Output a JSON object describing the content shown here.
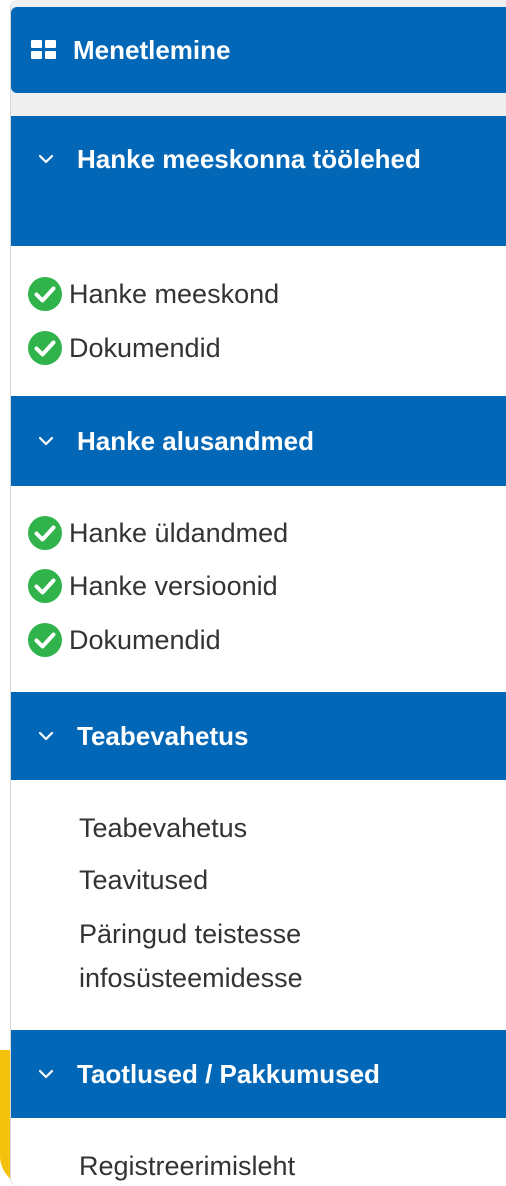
{
  "menu_header": {
    "label": "Menetlemine",
    "icon": "grid-icon"
  },
  "sections": [
    {
      "title": "Hanke meeskonna töölehed",
      "icon": "chevron-down-icon",
      "items": [
        {
          "label": "Hanke meeskond",
          "completed": true
        },
        {
          "label": "Dokumendid",
          "completed": true
        }
      ]
    },
    {
      "title": "Hanke alusandmed",
      "icon": "chevron-down-icon",
      "items": [
        {
          "label": "Hanke üldandmed",
          "completed": true
        },
        {
          "label": "Hanke versioonid",
          "completed": true
        },
        {
          "label": "Dokumendid",
          "completed": true
        }
      ]
    },
    {
      "title": "Teabevahetus",
      "icon": "chevron-down-icon",
      "items": [
        {
          "label": "Teabevahetus",
          "completed": false
        },
        {
          "label": "Teavitused",
          "completed": false
        },
        {
          "label": "Päringud teistesse infosüsteemidesse",
          "completed": false
        }
      ]
    },
    {
      "title": "Taotlused / Pakkumused",
      "icon": "chevron-down-icon",
      "items": [
        {
          "label": "Registreerimisleht",
          "completed": false
        }
      ]
    }
  ],
  "colors": {
    "header_blue": "#0367b7",
    "check_green": "#2fb34a",
    "accent_yellow": "#f4c20d"
  }
}
